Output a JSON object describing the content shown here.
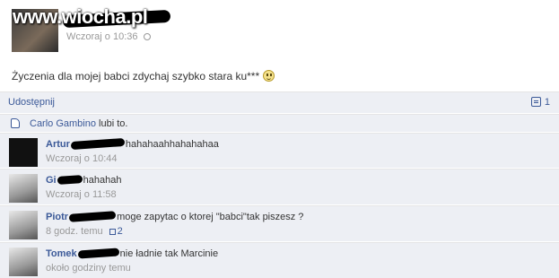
{
  "watermark": {
    "text": "www.wiocha.pl"
  },
  "post": {
    "timestamp": "Wczoraj o 10:36",
    "text": "Życzenia dla mojej babci zdychaj szybko stara ku***",
    "emoticon": "smiley-icon"
  },
  "actions": {
    "share_label": "Udostępnij",
    "comment_count": "1"
  },
  "likes": {
    "name": "Carlo Gambino",
    "suffix": "lubi to."
  },
  "comments": [
    {
      "author": "Artur",
      "text": "hahahaahhahahahaa",
      "time": "Wczoraj o 10:44",
      "likes": ""
    },
    {
      "author": "Gi",
      "text": "hahahah",
      "time": "Wczoraj o 11:58",
      "likes": ""
    },
    {
      "author": "Piotr",
      "text": "moge zapytac o ktorej \"babci\"tak piszesz ?",
      "time": "8 godz. temu",
      "likes": "2"
    },
    {
      "author": "Tomek",
      "text": "nie ładnie tak Marcinie",
      "time": "około godziny temu",
      "likes": ""
    }
  ],
  "colors": {
    "link": "#3b5998",
    "comment_bg": "#edeff4",
    "meta": "#999999"
  }
}
